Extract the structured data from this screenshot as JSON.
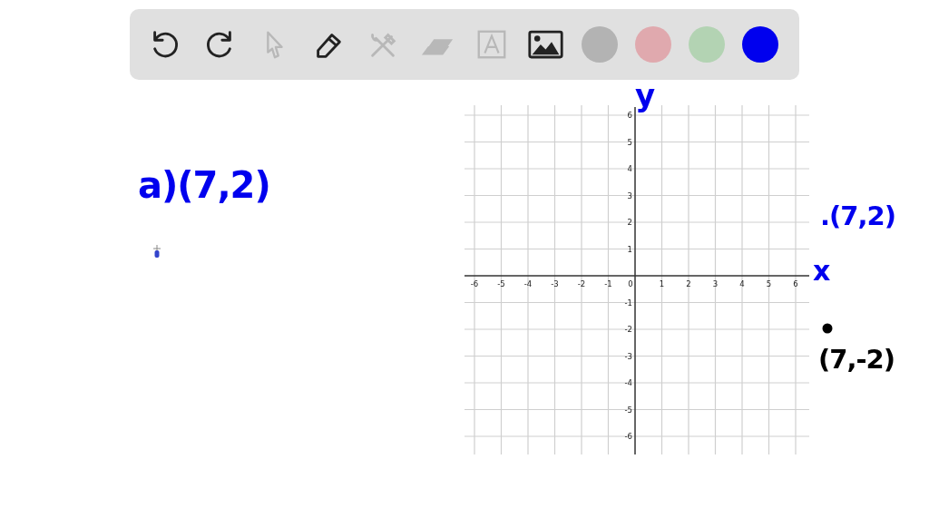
{
  "toolbar": {
    "tools": [
      {
        "kind": "undo",
        "disabled": false
      },
      {
        "kind": "redo",
        "disabled": false
      },
      {
        "kind": "pointer",
        "disabled": true
      },
      {
        "kind": "pen",
        "disabled": false
      },
      {
        "kind": "tools",
        "disabled": true
      },
      {
        "kind": "eraser",
        "disabled": true
      },
      {
        "kind": "text",
        "disabled": true
      },
      {
        "kind": "image",
        "disabled": false
      }
    ],
    "colors": [
      {
        "color": "#b3b3b3"
      },
      {
        "color": "#e0a9ae"
      },
      {
        "color": "#b3d3b3"
      },
      {
        "color": "#0000ee"
      }
    ]
  },
  "graph": {
    "x_ticks": [
      "-6",
      "-5",
      "-4",
      "-3",
      "-2",
      "-1",
      "0",
      "1",
      "2",
      "3",
      "4",
      "5",
      "6"
    ],
    "y_ticks": [
      "6",
      "5",
      "4",
      "3",
      "2",
      "1",
      "-1",
      "-2",
      "-3",
      "-4",
      "-5",
      "-6"
    ]
  },
  "annotations": [
    {
      "text": "a)(7,2)",
      "color": "#0000ee"
    },
    {
      "text": "y",
      "color": "#0000ee"
    },
    {
      "text": ".(7,2)",
      "color": "#0000ee"
    },
    {
      "text": "x",
      "color": "#0000ee"
    },
    {
      "text": "(7,-2)",
      "color": "#000000"
    }
  ]
}
